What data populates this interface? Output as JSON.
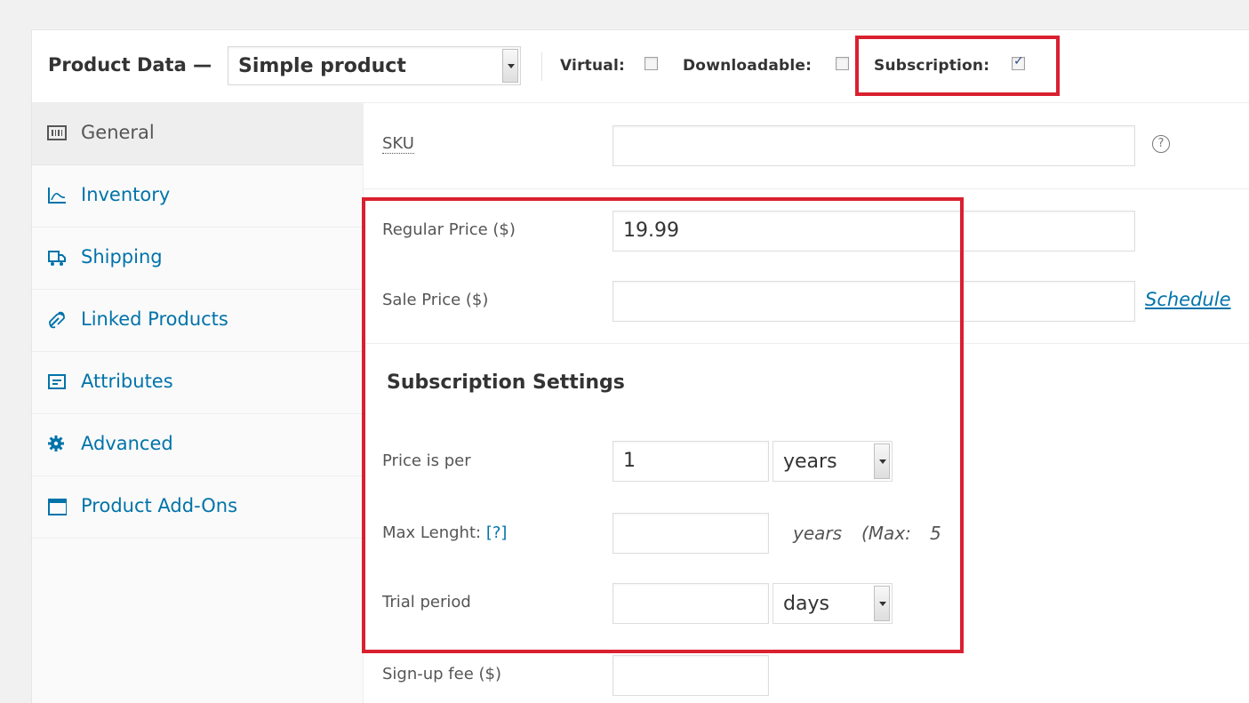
{
  "header": {
    "title": "Product Data —",
    "product_type": "Simple product",
    "virtual_label": "Virtual:",
    "downloadable_label": "Downloadable:",
    "subscription_label": "Subscription:",
    "virtual_checked": false,
    "downloadable_checked": false,
    "subscription_checked": true
  },
  "sidebar": {
    "tabs": [
      {
        "label": "General",
        "icon": "barcode-icon",
        "active": true
      },
      {
        "label": "Inventory",
        "icon": "inventory-chart-icon",
        "active": false
      },
      {
        "label": "Shipping",
        "icon": "truck-icon",
        "active": false
      },
      {
        "label": "Linked Products",
        "icon": "link-icon",
        "active": false
      },
      {
        "label": "Attributes",
        "icon": "attributes-icon",
        "active": false
      },
      {
        "label": "Advanced",
        "icon": "gear-icon",
        "active": false
      },
      {
        "label": "Product Add-Ons",
        "icon": "window-icon",
        "active": false
      }
    ]
  },
  "general": {
    "sku_label": "SKU",
    "sku_value": "",
    "regular_price_label": "Regular Price ($)",
    "regular_price_value": "19.99",
    "sale_price_label": "Sale Price ($)",
    "sale_price_value": "",
    "schedule_link": "Schedule"
  },
  "subscription": {
    "heading": "Subscription Settings",
    "price_per_label": "Price is per",
    "price_per_value": "1",
    "price_per_unit": "years",
    "max_length_label": "Max Lenght:",
    "max_length_help": "[?]",
    "max_length_value": "",
    "max_length_unit": "years",
    "max_note": "(Max:",
    "max_value": "5",
    "trial_label": "Trial period",
    "trial_value": "",
    "trial_unit": "days",
    "signup_fee_label": "Sign-up fee ($)",
    "signup_fee_value": ""
  },
  "colors": {
    "highlight": "#d9202f",
    "link": "#0073aa"
  }
}
